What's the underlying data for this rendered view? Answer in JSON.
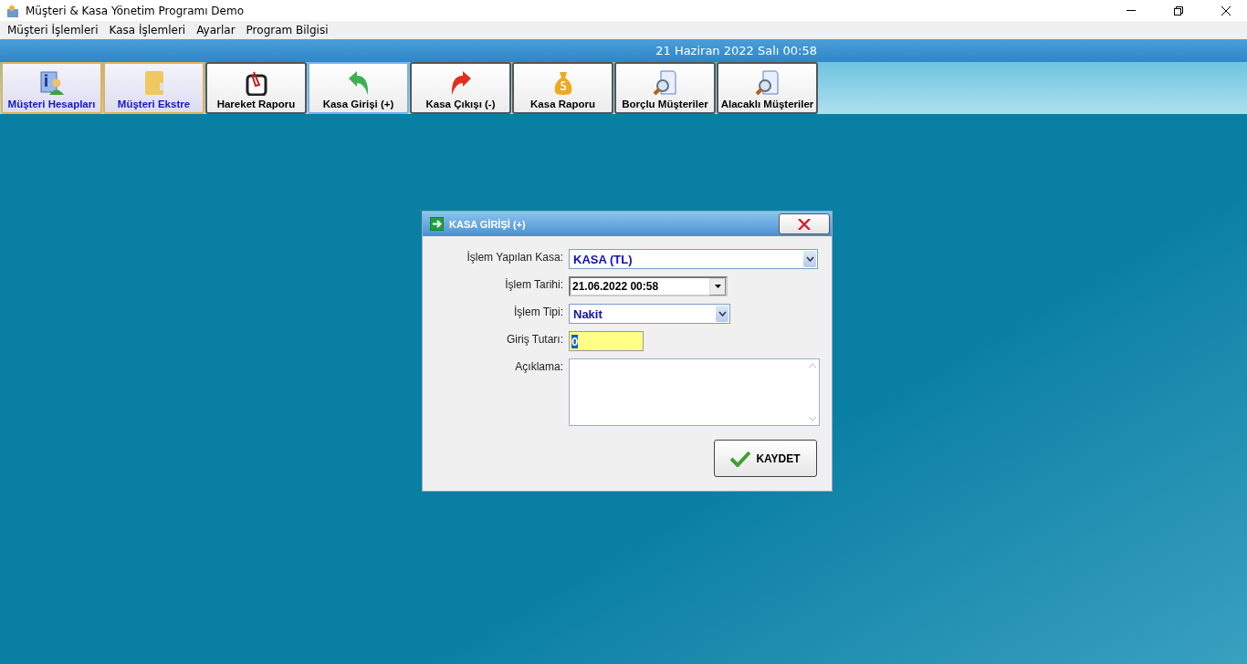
{
  "window": {
    "title": "Müşteri & Kasa Yönetim Programı Demo"
  },
  "menu": [
    "Müşteri İşlemleri",
    "Kasa İşlemleri",
    "Ayarlar",
    "Program Bilgisi"
  ],
  "date_bar": "21 Haziran 2022 Salı 00:58",
  "toolbar": [
    {
      "label": "Müşteri Hesapları",
      "selected": true,
      "focused": false
    },
    {
      "label": "Müşteri Ekstre",
      "selected": true,
      "focused": false
    },
    {
      "label": "Hareket Raporu",
      "selected": false,
      "focused": false
    },
    {
      "label": "Kasa Girişi (+)",
      "selected": false,
      "focused": true
    },
    {
      "label": "Kasa Çıkışı (-)",
      "selected": false,
      "focused": false
    },
    {
      "label": "Kasa Raporu",
      "selected": false,
      "focused": false
    },
    {
      "label": "Borçlu Müşteriler",
      "selected": false,
      "focused": false
    },
    {
      "label": "Alacaklı Müşteriler",
      "selected": false,
      "focused": false
    }
  ],
  "dialog": {
    "title": "KASA GİRİŞİ (+)",
    "fields": [
      {
        "label": "İşlem Yapılan Kasa:",
        "kind": "combo",
        "value": "KASA (TL)"
      },
      {
        "label": "İşlem Tarihi:",
        "kind": "date",
        "value": "21.06.2022 00:58"
      },
      {
        "label": "İşlem Tipi:",
        "kind": "combo-short",
        "value": "Nakit"
      },
      {
        "label": "Giriş Tutarı:",
        "kind": "amount",
        "value": "0"
      },
      {
        "label": "Açıklama:",
        "kind": "memo"
      }
    ],
    "save_button": "KAYDET"
  }
}
